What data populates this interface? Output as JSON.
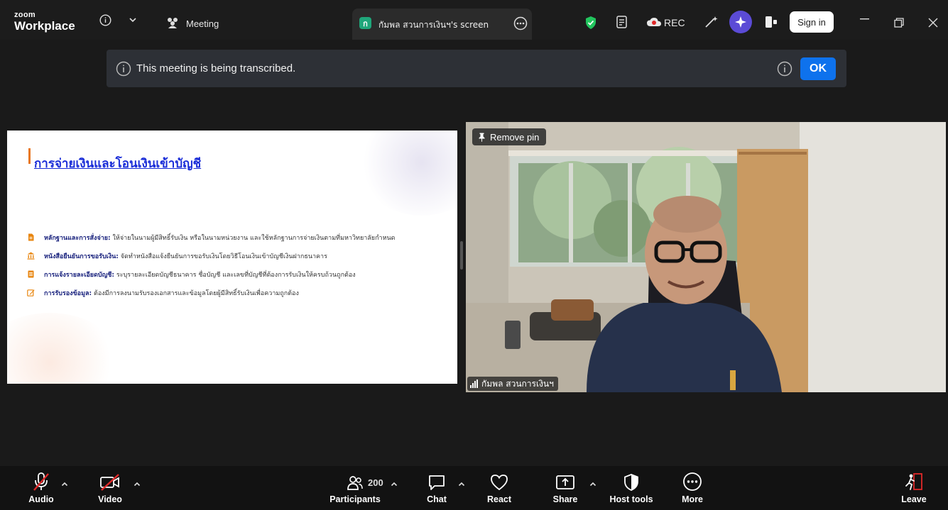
{
  "titlebar": {
    "logo_top": "zoom",
    "logo_bottom": "Workplace",
    "meeting_tab": "Meeting",
    "share_tab_badge": "ก",
    "share_tab_label": "กัมพล สวนการเงินฯ's screen",
    "rec_label": "REC",
    "signin_label": "Sign in",
    "shield_color": "#22c55e"
  },
  "banner": {
    "message": "This meeting is being transcribed.",
    "ok_label": "OK"
  },
  "slide": {
    "title": "การจ่ายเงินและโอนเงินเข้าบัญชี",
    "bullets": [
      {
        "icon": "document-icon",
        "heading": "หลักฐานและการสั่งจ่าย:",
        "text": " ให้จ่ายในนามผู้มีสิทธิ์รับเงิน หรือในนามหน่วยงาน และใช้หลักฐานการจ่ายเงินตามที่มหาวิทยาลัยกำหนด"
      },
      {
        "icon": "bank-icon",
        "heading": "หนังสือยืนยันการขอรับเงิน:",
        "text": " จัดทำหนังสือแจ้งยืนยันการขอรับเงินโดยวิธีโอนเงินเข้าบัญชีเงินฝากธนาคาร"
      },
      {
        "icon": "list-icon",
        "heading": "การแจ้งรายละเอียดบัญชี:",
        "text": " ระบุรายละเอียดบัญชีธนาคาร ชื่อบัญชี และเลขที่บัญชีที่ต้องการรับเงินให้ครบถ้วนถูกต้อง"
      },
      {
        "icon": "edit-icon",
        "heading": "การรับรองข้อมูล:",
        "text": " ต้องมีการลงนามรับรองเอกสารและข้อมูลโดยผู้มีสิทธิ์รับเงินเพื่อความถูกต้อง"
      }
    ]
  },
  "video": {
    "remove_pin_label": "Remove pin",
    "participant_name": "กัมพล สวนการเงินฯ"
  },
  "toolbar": {
    "audio": "Audio",
    "video": "Video",
    "participants": "Participants",
    "participant_count": "200",
    "chat": "Chat",
    "react": "React",
    "share": "Share",
    "host_tools": "Host tools",
    "more": "More",
    "leave": "Leave",
    "muted_color": "#e02828",
    "leave_color": "#e02828"
  }
}
